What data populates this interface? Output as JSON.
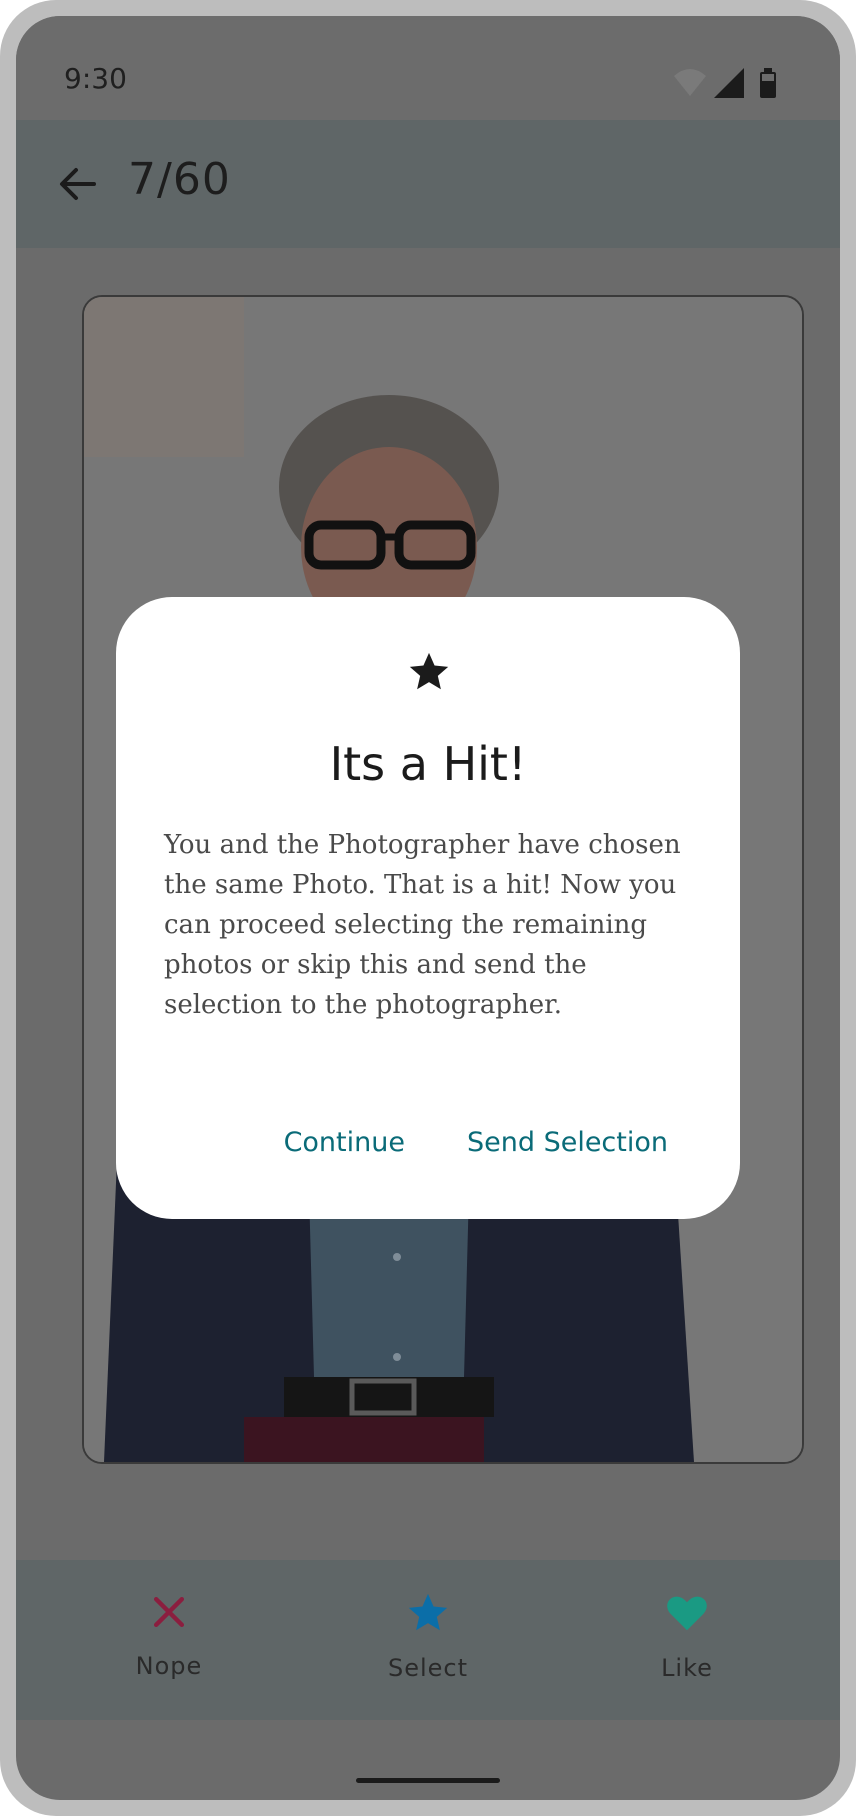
{
  "status_bar": {
    "time": "9:30",
    "icons": [
      "wifi-icon",
      "signal-icon",
      "battery-icon"
    ]
  },
  "app_bar": {
    "back_icon": "arrow-left-icon",
    "counter": "7/60"
  },
  "dialog": {
    "icon": "star-icon",
    "title": "Its a Hit!",
    "body": "You and the Photographer have chosen the same Photo. That is a hit! Now you can proceed selecting the remaining photos or skip this and send the selection to the photographer.",
    "continue_label": "Continue",
    "send_label": "Send Selection"
  },
  "bottom_nav": {
    "items": [
      {
        "label": "Nope",
        "icon": "close-icon",
        "color": "#8b1e3f"
      },
      {
        "label": "Select",
        "icon": "star-icon",
        "color": "#0b6ea8"
      },
      {
        "label": "Like",
        "icon": "heart-icon",
        "color": "#1a9a83"
      }
    ]
  },
  "colors": {
    "accent": "#0a6b78",
    "scrim": "#6b6b6b",
    "surface": "#ffffff"
  }
}
